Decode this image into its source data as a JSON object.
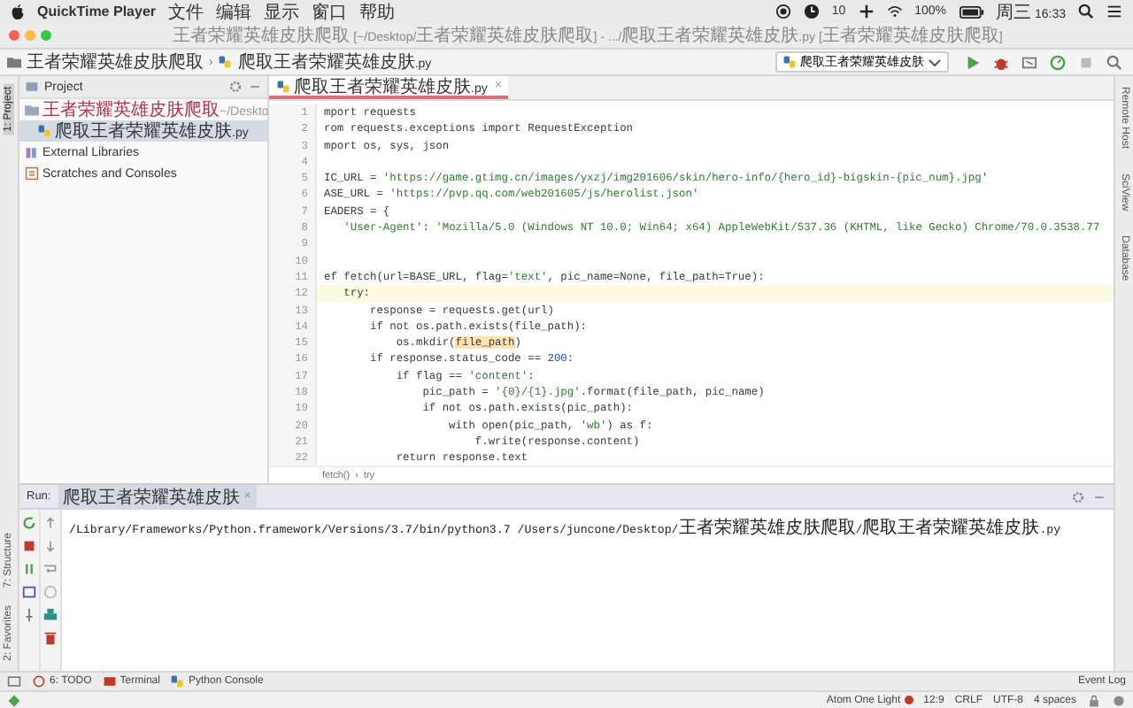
{
  "menu_bar": {
    "app": "QuickTime Player",
    "items": [
      "文件",
      "编辑",
      "显示",
      "窗口",
      "帮助"
    ],
    "status": [
      "10",
      "100%",
      "周三 16:33"
    ]
  },
  "window": {
    "title": "王者荣耀英雄皮肤爬取 [~/Desktop/王者荣耀英雄皮肤爬取] - .../爬取王者荣耀英雄皮肤.py [王者荣耀英雄皮肤爬取]"
  },
  "nav_bar": {
    "breadcrumb": [
      "王者荣耀英雄皮肤爬取",
      "爬取王者荣耀英雄皮肤.py"
    ],
    "separator": "›",
    "run_config": "爬取王者荣耀英雄皮肤"
  },
  "left_strip": {
    "top": [
      {
        "label": "1: Project",
        "selected": true
      }
    ],
    "bottom": [
      {
        "label": "7: Structure",
        "selected": false
      },
      {
        "label": "2: Favorites",
        "selected": false
      }
    ]
  },
  "project_panel": {
    "title": "Project",
    "tree": [
      {
        "label": "王者荣耀英雄皮肤爬取",
        "path": "~/Deskto",
        "kind": "folder",
        "selected": false,
        "children": [
          {
            "label": "爬取王者荣耀英雄皮肤.py",
            "kind": "python",
            "selected": true
          }
        ]
      },
      {
        "label": "External Libraries",
        "kind": "library",
        "selected": false
      },
      {
        "label": "Scratches and Consoles",
        "kind": "scratch",
        "selected": false
      }
    ]
  },
  "editor": {
    "tabs": [
      {
        "label": "爬取王者荣耀英雄皮肤.py",
        "close": "×",
        "selected": true
      }
    ],
    "lines": [
      {
        "number": "1",
        "current": false,
        "tokens": [
          {
            "kind": "plain",
            "text": "mport requests"
          }
        ]
      },
      {
        "number": "2",
        "current": false,
        "tokens": [
          {
            "kind": "plain",
            "text": "rom requests.exceptions import RequestException"
          }
        ]
      },
      {
        "number": "3",
        "current": false,
        "tokens": [
          {
            "kind": "plain",
            "text": "mport os, sys, json"
          }
        ]
      },
      {
        "number": "4",
        "current": false
      },
      {
        "number": "5",
        "current": false,
        "tokens": [
          {
            "kind": "plain",
            "text": "IC_URL = "
          },
          {
            "kind": "str",
            "text": "'https://game.gtimg.cn/images/yxzj/img201606/skin/hero-info/{hero_id}-bigskin-{pic_num}.jpg'"
          }
        ]
      },
      {
        "number": "6",
        "current": false,
        "tokens": [
          {
            "kind": "plain",
            "text": "ASE_URL = "
          },
          {
            "kind": "str",
            "text": "'https://pvp.qq.com/web201605/js/herolist.json'"
          }
        ]
      },
      {
        "number": "7",
        "current": false,
        "tokens": [
          {
            "kind": "plain",
            "text": "EADERS = {"
          }
        ]
      },
      {
        "number": "8",
        "current": false,
        "tokens": [
          {
            "kind": "str",
            "text": "   'User-Agent'"
          },
          {
            "kind": "plain",
            "text": ": "
          },
          {
            "kind": "str",
            "text": "'Mozilla/5.0 (Windows NT 10.0; Win64; x64) AppleWebKit/537.36 (KHTML, like Gecko) Chrome/70.0.3538.77"
          }
        ]
      },
      {
        "number": "9",
        "current": false
      },
      {
        "number": "10",
        "current": false
      },
      {
        "number": "11",
        "current": false,
        "tokens": [
          {
            "kind": "plain",
            "text": "ef fetch(url=BASE_URL, flag="
          },
          {
            "kind": "str",
            "text": "'text'"
          },
          {
            "kind": "plain",
            "text": ", pic_name=None, file_path=True):"
          }
        ]
      },
      {
        "number": "12",
        "current": true,
        "tokens": [
          {
            "kind": "plain",
            "text": "   try:"
          }
        ]
      },
      {
        "number": "13",
        "current": false,
        "tokens": [
          {
            "kind": "plain",
            "text": "       response = requests.get(url)"
          }
        ]
      },
      {
        "number": "14",
        "current": false,
        "tokens": [
          {
            "kind": "plain",
            "text": "       if not os.path.exists(file_path):"
          }
        ]
      },
      {
        "number": "15",
        "current": false,
        "tokens": [
          {
            "kind": "plain",
            "text": "           os.mkdir("
          },
          {
            "kind": "mark",
            "text": "file_path"
          },
          {
            "kind": "plain",
            "text": ")"
          }
        ]
      },
      {
        "number": "16",
        "current": false,
        "tokens": [
          {
            "kind": "plain",
            "text": "       if response.status_code == "
          },
          {
            "kind": "num",
            "text": "200"
          },
          {
            "kind": "plain",
            "text": ":"
          }
        ]
      },
      {
        "number": "17",
        "current": false,
        "tokens": [
          {
            "kind": "plain",
            "text": "           if flag == "
          },
          {
            "kind": "str",
            "text": "'content'"
          },
          {
            "kind": "plain",
            "text": ":"
          }
        ]
      },
      {
        "number": "18",
        "current": false,
        "tokens": [
          {
            "kind": "plain",
            "text": "               pic_path = "
          },
          {
            "kind": "str",
            "text": "'{0}/{1}.jpg'"
          },
          {
            "kind": "plain",
            "text": ".format(file_path, pic_name)"
          }
        ]
      },
      {
        "number": "19",
        "current": false,
        "tokens": [
          {
            "kind": "plain",
            "text": "               if not os.path.exists(pic_path):"
          }
        ]
      },
      {
        "number": "20",
        "current": false,
        "tokens": [
          {
            "kind": "plain",
            "text": "                   with open(pic_path, "
          },
          {
            "kind": "str",
            "text": "'wb'"
          },
          {
            "kind": "plain",
            "text": ") as f:"
          }
        ]
      },
      {
        "number": "21",
        "current": false,
        "tokens": [
          {
            "kind": "plain",
            "text": "                       f.write(response.content)"
          }
        ]
      },
      {
        "number": "22",
        "current": false,
        "tokens": [
          {
            "kind": "plain",
            "text": "           return response.text"
          }
        ]
      }
    ],
    "breadcrumb": [
      "fetch()",
      "try"
    ],
    "breadcrumb_separator": "›"
  },
  "right_strip": [
    "Remote Host",
    "SciView",
    "Database"
  ],
  "run_panel": {
    "label": "Run:",
    "tabs": [
      {
        "label": "爬取王者荣耀英雄皮肤",
        "close": "×",
        "selected": true
      }
    ],
    "output": [
      "/Library/Frameworks/Python.framework/Versions/3.7/bin/python3.7 /Users/juncone/Desktop/王者荣耀英雄皮肤爬取/爬取王者荣耀英雄皮肤.py"
    ]
  },
  "bottom_tool_tabs": [
    {
      "label": "6: TODO",
      "kind": "todo"
    },
    {
      "label": "Terminal",
      "kind": "terminal"
    },
    {
      "label": "Python Console",
      "kind": "python"
    }
  ],
  "event_log": "Event Log",
  "status_bar": {
    "theme": "Atom One Light",
    "position": "12:9",
    "line_separator": "CRLF",
    "encoding": "UTF-8",
    "indent": "4 spaces"
  }
}
